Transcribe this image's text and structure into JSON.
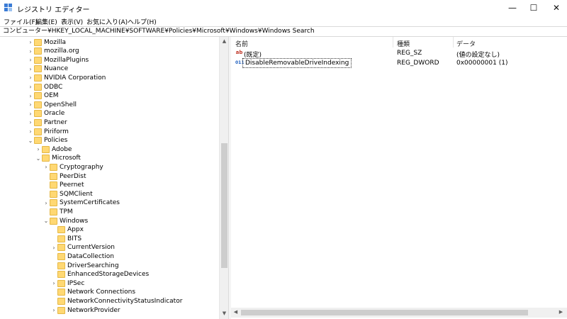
{
  "window": {
    "title": "レジストリ エディター",
    "controls": {
      "minimize": "—",
      "maximize": "☐",
      "close": "✕"
    }
  },
  "menu": {
    "items": [
      "ファイル(F)",
      "編集(E)",
      "表示(V)",
      "お気に入り(A)",
      "ヘルプ(H)"
    ]
  },
  "address": {
    "path": "コンピューター¥HKEY_LOCAL_MACHINE¥SOFTWARE¥Policies¥Microsoft¥Windows¥Windows Search"
  },
  "tree": {
    "items": [
      {
        "label": "Mozilla",
        "level": 0,
        "expanded": false
      },
      {
        "label": "mozilla.org",
        "level": 0,
        "expanded": false
      },
      {
        "label": "MozillaPlugins",
        "level": 0,
        "expanded": false
      },
      {
        "label": "Nuance",
        "level": 0,
        "expanded": false
      },
      {
        "label": "NVIDIA Corporation",
        "level": 0,
        "expanded": false
      },
      {
        "label": "ODBC",
        "level": 0,
        "expanded": false
      },
      {
        "label": "OEM",
        "level": 0,
        "expanded": false
      },
      {
        "label": "OpenShell",
        "level": 0,
        "expanded": false
      },
      {
        "label": "Oracle",
        "level": 0,
        "expanded": false
      },
      {
        "label": "Partner",
        "level": 0,
        "expanded": false
      },
      {
        "label": "Piriform",
        "level": 0,
        "expanded": false
      },
      {
        "label": "Policies",
        "level": 0,
        "expanded": true
      },
      {
        "label": "Adobe",
        "level": 1,
        "expanded": false
      },
      {
        "label": "Microsoft",
        "level": 1,
        "expanded": true
      },
      {
        "label": "Cryptography",
        "level": 2,
        "expanded": false
      },
      {
        "label": "PeerDist",
        "level": 2,
        "expanded": null
      },
      {
        "label": "Peernet",
        "level": 2,
        "expanded": null
      },
      {
        "label": "SQMClient",
        "level": 2,
        "expanded": null
      },
      {
        "label": "SystemCertificates",
        "level": 2,
        "expanded": false
      },
      {
        "label": "TPM",
        "level": 2,
        "expanded": null
      },
      {
        "label": "Windows",
        "level": 2,
        "expanded": true
      },
      {
        "label": "Appx",
        "level": 3,
        "expanded": null
      },
      {
        "label": "BITS",
        "level": 3,
        "expanded": null
      },
      {
        "label": "CurrentVersion",
        "level": 3,
        "expanded": false
      },
      {
        "label": "DataCollection",
        "level": 3,
        "expanded": null
      },
      {
        "label": "DriverSearching",
        "level": 3,
        "expanded": null
      },
      {
        "label": "EnhancedStorageDevices",
        "level": 3,
        "expanded": null
      },
      {
        "label": "IPSec",
        "level": 3,
        "expanded": false
      },
      {
        "label": "Network Connections",
        "level": 3,
        "expanded": null
      },
      {
        "label": "NetworkConnectivityStatusIndicator",
        "level": 3,
        "expanded": null
      },
      {
        "label": "NetworkProvider",
        "level": 3,
        "expanded": false
      }
    ]
  },
  "list": {
    "columns": [
      "名前",
      "種類",
      "データ"
    ],
    "rows": [
      {
        "icon": "ab",
        "name": "(既定)",
        "type": "REG_SZ",
        "data": "(値の設定なし)"
      },
      {
        "icon": "011",
        "name": "DisableRemovableDriveIndexing",
        "type": "REG_DWORD",
        "data": "0x00000001 (1)"
      }
    ]
  },
  "colors": {
    "folder": "#ffd873",
    "string_icon": "#c0392b",
    "dword_icon": "#1f5fbf"
  }
}
